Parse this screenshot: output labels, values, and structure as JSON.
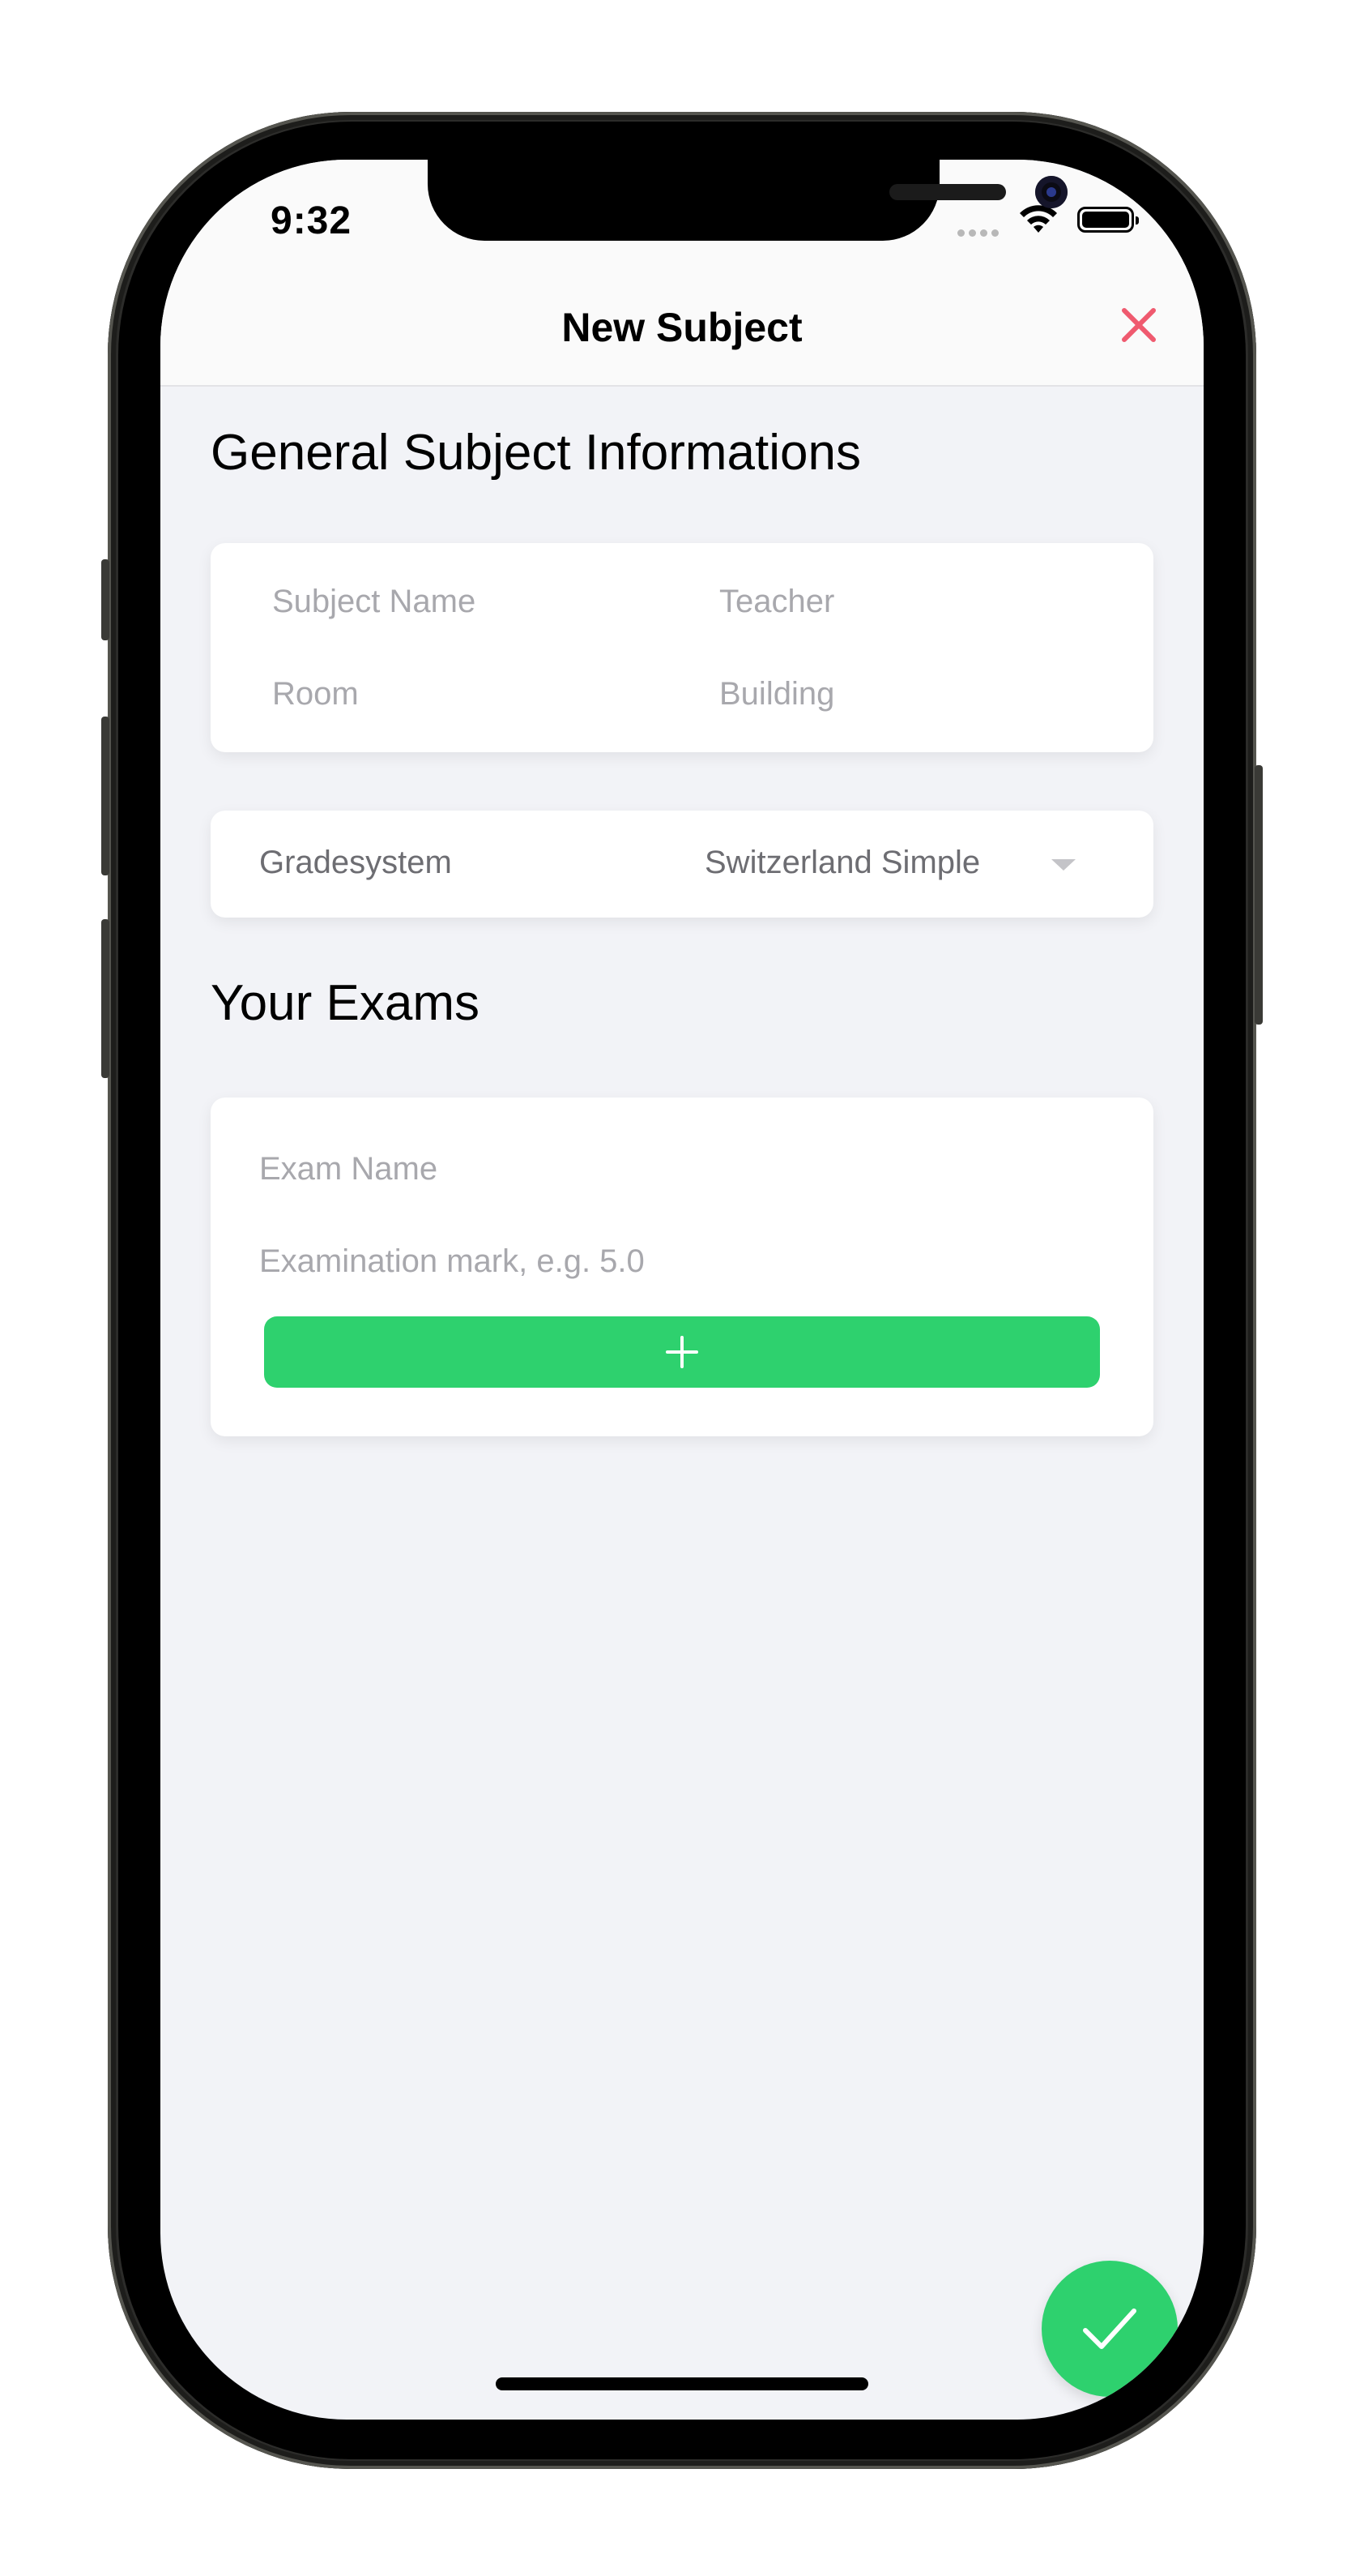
{
  "status_bar": {
    "time": "9:32"
  },
  "header": {
    "title": "New Subject"
  },
  "general": {
    "title": "General Subject Informations",
    "subject_name_placeholder": "Subject Name",
    "teacher_placeholder": "Teacher",
    "room_placeholder": "Room",
    "building_placeholder": "Building"
  },
  "gradesystem": {
    "label": "Gradesystem",
    "selected": "Switzerland Simple"
  },
  "exams": {
    "title": "Your Exams",
    "exam_name_placeholder": "Exam Name",
    "mark_placeholder": "Examination mark, e.g. 5.0"
  },
  "icons": {
    "close": "close-icon",
    "add": "plus-icon",
    "confirm": "checkmark-icon",
    "wifi": "wifi-icon",
    "battery": "battery-icon",
    "signal": "signal-icon",
    "dropdown": "chevron-down-icon"
  },
  "colors": {
    "accent_green": "#2ed16e",
    "close_red": "#ef5a6f",
    "background": "#f2f3f7",
    "card": "#ffffff"
  }
}
